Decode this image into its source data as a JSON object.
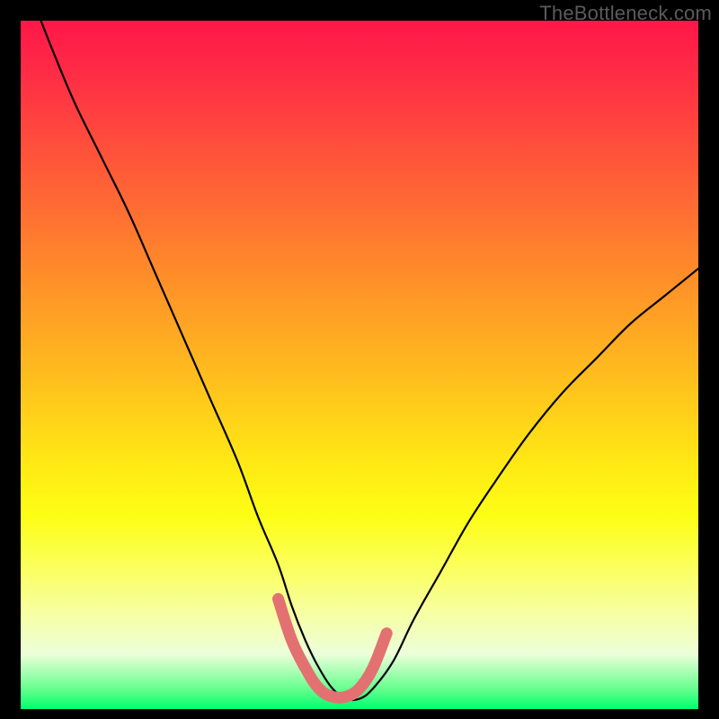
{
  "watermark": "TheBottleneck.com",
  "chart_data": {
    "type": "line",
    "title": "",
    "xlabel": "",
    "ylabel": "",
    "xlim": [
      0,
      100
    ],
    "ylim": [
      0,
      100
    ],
    "series": [
      {
        "name": "bottleneck-curve",
        "x": [
          3,
          5,
          8,
          12,
          16,
          20,
          24,
          28,
          32,
          35,
          38,
          40,
          42,
          44,
          46,
          48,
          50,
          52,
          55,
          58,
          62,
          66,
          70,
          75,
          80,
          85,
          90,
          95,
          100
        ],
        "y": [
          100,
          95,
          88,
          80,
          72,
          63,
          54,
          45,
          36,
          28,
          21,
          15,
          10,
          6,
          3,
          1.5,
          1.5,
          3,
          7,
          13,
          20,
          27,
          33,
          40,
          46,
          51,
          56,
          60,
          64
        ]
      },
      {
        "name": "highlight-segment",
        "x": [
          38,
          40,
          42,
          44,
          46,
          48,
          50,
          52,
          54
        ],
        "y": [
          16,
          10,
          6,
          3,
          1.8,
          1.8,
          3,
          6,
          11
        ]
      }
    ],
    "colors": {
      "curve": "#000000",
      "highlight": "#e37171",
      "frame": "#000000"
    }
  }
}
